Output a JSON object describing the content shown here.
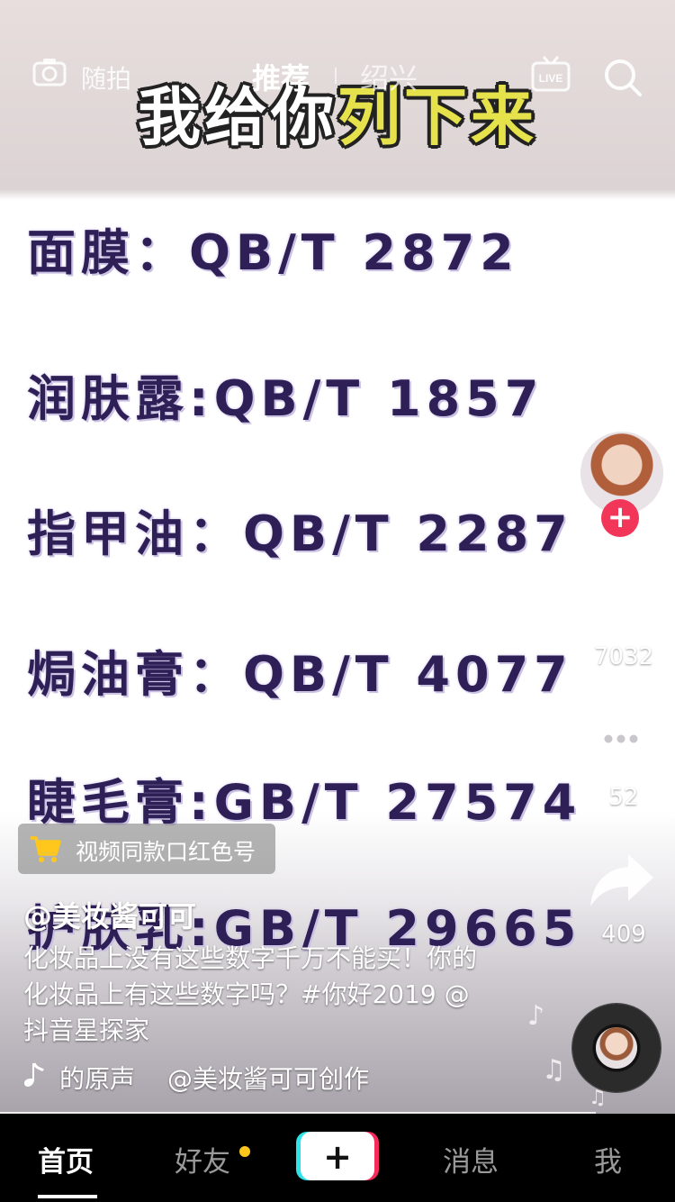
{
  "video": {
    "title_part1": "我给你",
    "title_part2": "列下来",
    "standards": [
      "面膜：QB/T 2872",
      "润肤露:QB/T 1857",
      "指甲油：QB/T 2287",
      "焗油膏：QB/T 4077",
      "睫毛膏:GB/T 27574",
      "护肤乳:GB/T 29665"
    ]
  },
  "topbar": {
    "snap_label": "随拍",
    "tab_recommend": "推荐",
    "tab_city": "绍兴",
    "live_label": "LIVE"
  },
  "rail": {
    "likes": "7032",
    "comments": "52",
    "shares": "409"
  },
  "cart": {
    "label": "视频同款口红色号"
  },
  "post": {
    "author": "@美妆酱可可",
    "caption": "化妆品上没有这些数字千万不能买！你的化妆品上有这些数字吗？#你好2019 @抖音星探家",
    "music_original": "的原声",
    "music_creator": "@美妆酱可可创作"
  },
  "nav": {
    "home": "首页",
    "friends": "好友",
    "plus": "+",
    "messages": "消息",
    "me": "我"
  },
  "colors": {
    "accent_red": "#f2365a",
    "tiktok_cyan": "#31e2e8",
    "tiktok_pink": "#f52b5b",
    "title_yellow": "#e6e24b",
    "cart_yellow": "#ffc71c"
  },
  "icons": [
    "camera-icon",
    "live-icon",
    "search-icon",
    "heart-icon",
    "comment-icon",
    "share-icon",
    "cart-icon",
    "music-note-icon"
  ]
}
